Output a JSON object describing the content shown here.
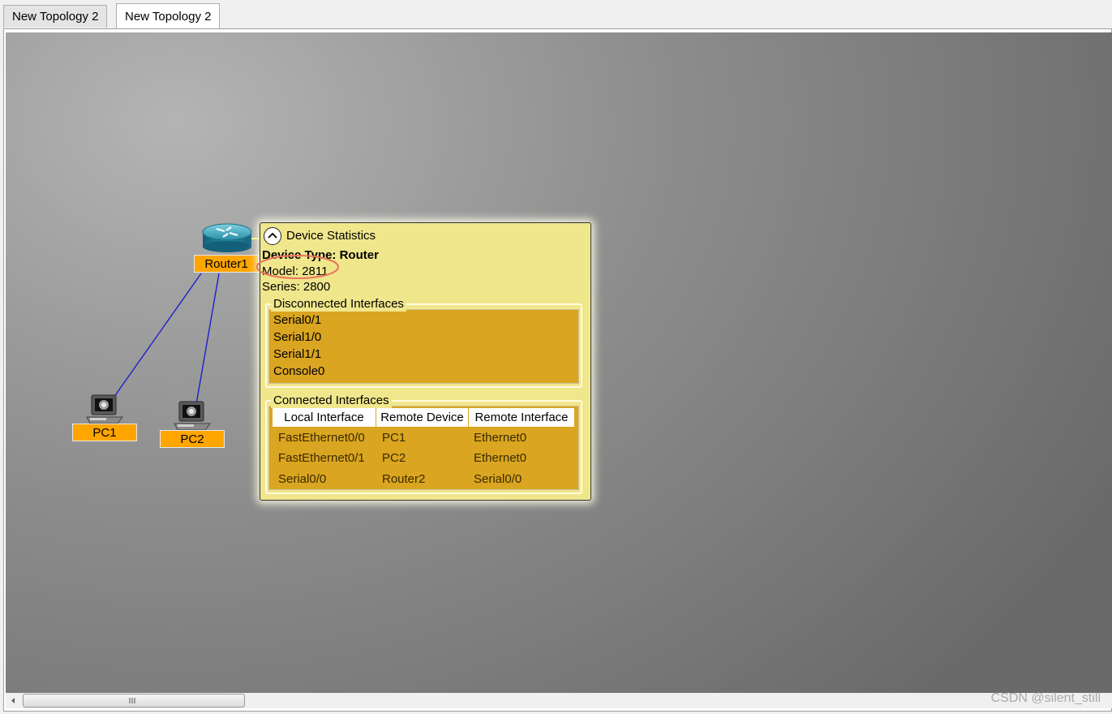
{
  "tabs": [
    {
      "label": "New Topology 2",
      "active": false
    },
    {
      "label": "New Topology 2",
      "active": true
    }
  ],
  "devices": {
    "router": {
      "label": "Router1",
      "icon": "router-icon"
    },
    "pc1": {
      "label": "PC1",
      "icon": "pc-icon"
    },
    "pc2": {
      "label": "PC2",
      "icon": "pc-icon"
    }
  },
  "stats": {
    "title": "Device Statistics",
    "device_type": "Device Type: Router",
    "model": "Model: 2811",
    "series": "Series: 2800",
    "disconnected": {
      "title": "Disconnected Interfaces",
      "items": [
        "Serial0/1",
        "Serial1/0",
        "Serial1/1",
        "Console0"
      ]
    },
    "connected": {
      "title": "Connected Interfaces",
      "headers": [
        "Local Interface",
        "Remote Device",
        "Remote Interface"
      ],
      "rows": [
        [
          "FastEthernet0/0",
          "PC1",
          "Ethernet0"
        ],
        [
          "FastEthernet0/1",
          "PC2",
          "Ethernet0"
        ],
        [
          "Serial0/0",
          "Router2",
          "Serial0/0"
        ]
      ]
    }
  },
  "watermark": "CSDN @silent_still",
  "colors": {
    "device_label": "#ffa500",
    "panel_bg": "#f0e68c",
    "interface_bg": "#daa520",
    "link": "#1f1fcc",
    "highlight_circle": "#e8735a"
  }
}
